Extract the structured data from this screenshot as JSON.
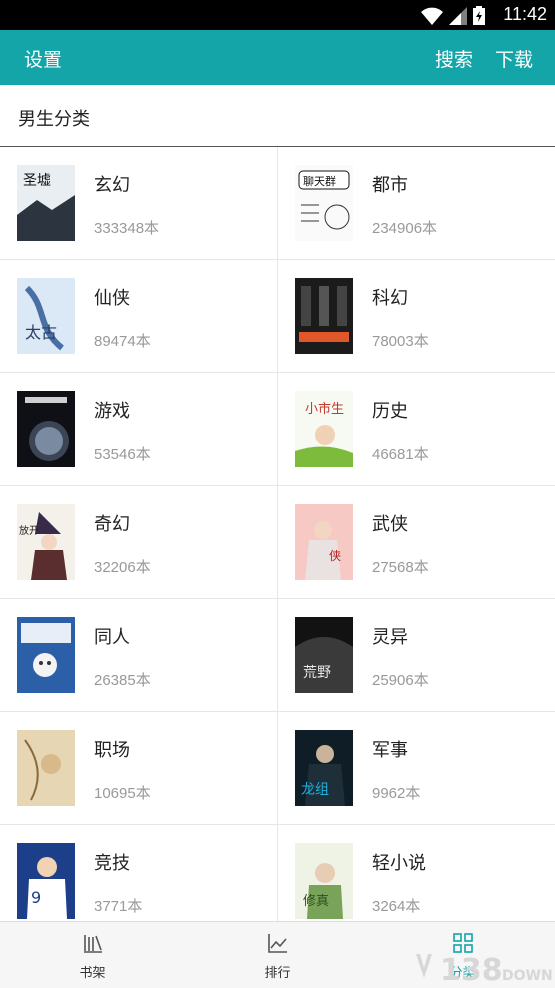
{
  "status": {
    "time": "11:42"
  },
  "appbar": {
    "title": "设置",
    "search": "搜索",
    "download": "下载"
  },
  "section": {
    "title": "男生分类"
  },
  "categories": [
    {
      "name": "玄幻",
      "count": "333348本",
      "cover": "cover-xuanhuan"
    },
    {
      "name": "都市",
      "count": "234906本",
      "cover": "cover-dushi"
    },
    {
      "name": "仙侠",
      "count": "89474本",
      "cover": "cover-xianxia"
    },
    {
      "name": "科幻",
      "count": "78003本",
      "cover": "cover-kehuan"
    },
    {
      "name": "游戏",
      "count": "53546本",
      "cover": "cover-youxi"
    },
    {
      "name": "历史",
      "count": "46681本",
      "cover": "cover-lishi"
    },
    {
      "name": "奇幻",
      "count": "32206本",
      "cover": "cover-qihuan"
    },
    {
      "name": "武侠",
      "count": "27568本",
      "cover": "cover-wuxia"
    },
    {
      "name": "同人",
      "count": "26385本",
      "cover": "cover-tongren"
    },
    {
      "name": "灵异",
      "count": "25906本",
      "cover": "cover-lingyi"
    },
    {
      "name": "职场",
      "count": "10695本",
      "cover": "cover-zhichang"
    },
    {
      "name": "军事",
      "count": "9962本",
      "cover": "cover-junshi"
    },
    {
      "name": "竞技",
      "count": "3771本",
      "cover": "cover-jingji"
    },
    {
      "name": "轻小说",
      "count": "3264本",
      "cover": "cover-qingxiaoshuo"
    }
  ],
  "tabs": [
    {
      "label": "书架",
      "icon": "bookshelf-icon"
    },
    {
      "label": "排行",
      "icon": "ranking-chart-icon"
    },
    {
      "label": "分类",
      "icon": "category-grid-icon"
    }
  ],
  "watermark": {
    "text": "138DOWN"
  },
  "colors": {
    "accent": "#13a5a8",
    "muted": "#999999"
  }
}
